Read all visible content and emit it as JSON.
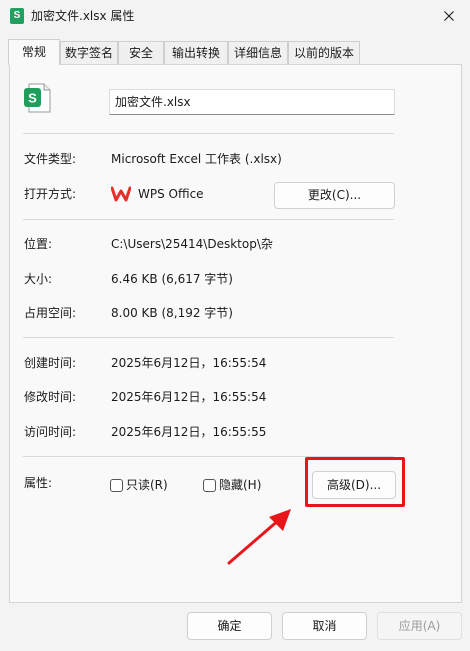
{
  "window": {
    "title": "加密文件.xlsx 属性",
    "app_icon": "spreadsheet-icon",
    "close_icon": "close-icon"
  },
  "tabs": [
    {
      "label": "常规",
      "active": true
    },
    {
      "label": "数字签名",
      "active": false
    },
    {
      "label": "安全",
      "active": false
    },
    {
      "label": "输出转换",
      "active": false
    },
    {
      "label": "详细信息",
      "active": false
    },
    {
      "label": "以前的版本",
      "active": false
    }
  ],
  "general": {
    "file_name": "加密文件.xlsx",
    "type_label": "文件类型:",
    "type_value": "Microsoft Excel 工作表 (.xlsx)",
    "open_with_label": "打开方式:",
    "open_with_value": "WPS Office",
    "open_with_icon": "wps-office-icon",
    "change_button": "更改(C)...",
    "location_label": "位置:",
    "location_value": "C:\\Users\\25414\\Desktop\\杂",
    "size_label": "大小:",
    "size_value": "6.46 KB (6,617 字节)",
    "size_on_disk_label": "占用空间:",
    "size_on_disk_value": "8.00 KB (8,192 字节)",
    "created_label": "创建时间:",
    "created_value": "2025年6月12日，16:55:54",
    "modified_label": "修改时间:",
    "modified_value": "2025年6月12日，16:55:54",
    "accessed_label": "访问时间:",
    "accessed_value": "2025年6月12日，16:55:55",
    "attributes_label": "属性:",
    "readonly_label": "只读(R)",
    "readonly_checked": false,
    "hidden_label": "隐藏(H)",
    "hidden_checked": false,
    "advanced_button": "高级(D)..."
  },
  "footer": {
    "ok": "确定",
    "cancel": "取消",
    "apply": "应用(A)"
  },
  "annotation": {
    "highlight_color": "#e8151b"
  }
}
